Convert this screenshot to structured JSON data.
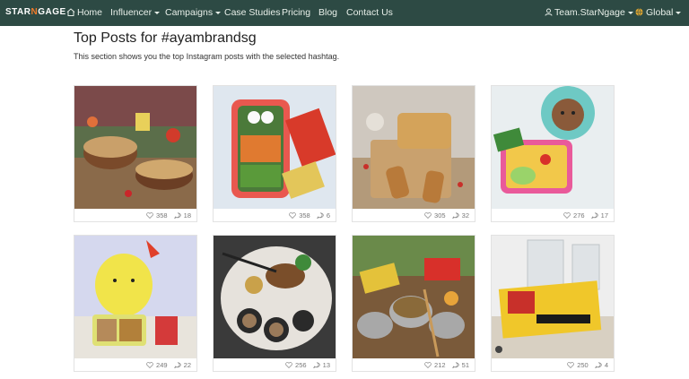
{
  "nav": {
    "logo": "STARNGAGE",
    "home": "Home",
    "influencer": "Influencer",
    "campaigns": "Campaigns",
    "case_studies": "Case Studies",
    "pricing": "Pricing",
    "blog": "Blog",
    "contact": "Contact Us",
    "account": "Team.StarNgage",
    "region": "Global"
  },
  "page": {
    "title": "Top Posts for #ayambrandsg",
    "subtitle": "This section shows you the top Instagram posts with the selected hashtag."
  },
  "posts": [
    {
      "likes": "358",
      "comments": "18"
    },
    {
      "likes": "358",
      "comments": "6"
    },
    {
      "likes": "305",
      "comments": "32"
    },
    {
      "likes": "276",
      "comments": "17"
    },
    {
      "likes": "249",
      "comments": "22"
    },
    {
      "likes": "256",
      "comments": "13"
    },
    {
      "likes": "212",
      "comments": "51"
    },
    {
      "likes": "250",
      "comments": "4"
    }
  ],
  "colors": {
    "navbar": "#2d4a44",
    "accent": "#f07a2a"
  },
  "icons": [
    "home-icon",
    "user-icon",
    "globe-icon",
    "heart-icon",
    "comment-icon",
    "chevron-down-icon"
  ]
}
